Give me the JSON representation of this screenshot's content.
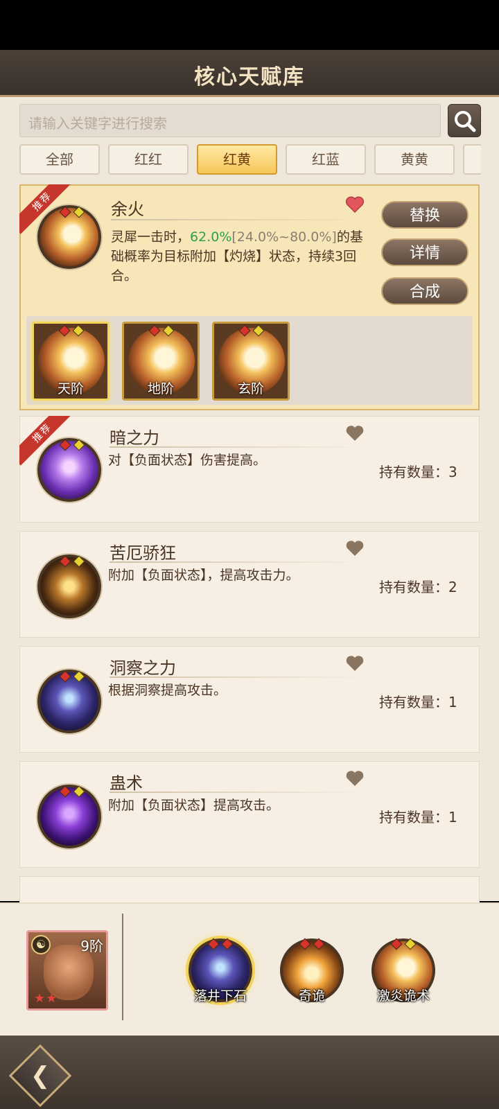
{
  "header": {
    "title": "核心天赋库"
  },
  "search": {
    "placeholder": "请输入关键字进行搜索"
  },
  "tabs": [
    {
      "label": "全部"
    },
    {
      "label": "红红"
    },
    {
      "label": "红黄",
      "active": true
    },
    {
      "label": "红蓝"
    },
    {
      "label": "黄黄"
    }
  ],
  "expanded_card": {
    "badge": "推荐",
    "name": "余火",
    "desc_part1": "灵犀一击时，",
    "desc_value": "62.0%",
    "desc_range": "[24.0%~80.0%]",
    "desc_part2": "的基础概率为目标附加【灼烧】状态，持续3回合。",
    "buttons": {
      "replace": "替换",
      "details": "详情",
      "combine": "合成"
    },
    "grades": [
      {
        "label": "天阶",
        "selected": true
      },
      {
        "label": "地阶"
      },
      {
        "label": "玄阶"
      }
    ]
  },
  "talents": [
    {
      "name": "暗之力",
      "badge": "推荐",
      "desc": "对【负面状态】伤害提高。",
      "count": "持有数量：3"
    },
    {
      "name": "苦厄骄狂",
      "desc": "附加【负面状态】，提高攻击力。",
      "count": "持有数量：2"
    },
    {
      "name": "洞察之力",
      "desc": "根据洞察提高攻击。",
      "count": "持有数量：1"
    },
    {
      "name": "蛊术",
      "desc": "附加【负面状态】提高攻击。",
      "count": "持有数量：1"
    }
  ],
  "hero": {
    "level": "9阶",
    "stars": "★★"
  },
  "equipped": [
    {
      "label": "落井下石"
    },
    {
      "label": "奇诡"
    },
    {
      "label": "激炎诡术"
    }
  ],
  "colors": {
    "accent": "#f6c659",
    "highlight_green": "#2da04a",
    "recommend_red": "#c7362c"
  }
}
